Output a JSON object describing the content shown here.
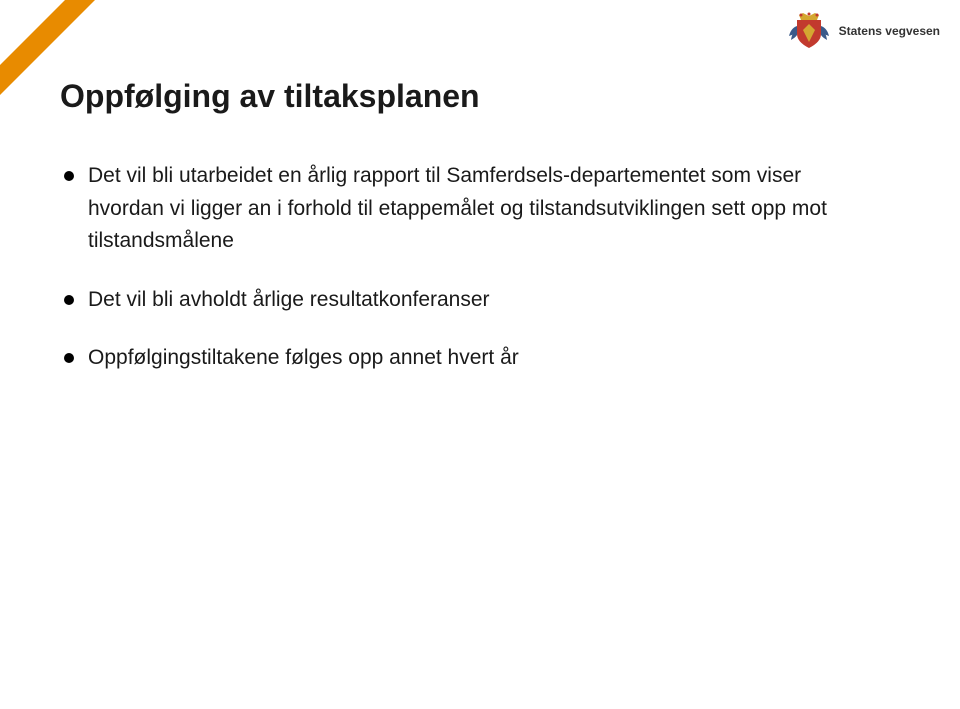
{
  "logo": {
    "org_name": "Statens vegvesen"
  },
  "slide": {
    "title": "Oppfølging av tiltaksplanen",
    "bullets": [
      "Det vil bli utarbeidet en årlig rapport til Samferdsels-departementet som viser hvordan vi ligger an i forhold til etappemålet og tilstandsutviklingen sett opp mot tilstandsmålene",
      "Det vil bli avholdt årlige resultatkonferanser",
      "Oppfølgingstiltakene følges opp annet hvert år"
    ]
  }
}
